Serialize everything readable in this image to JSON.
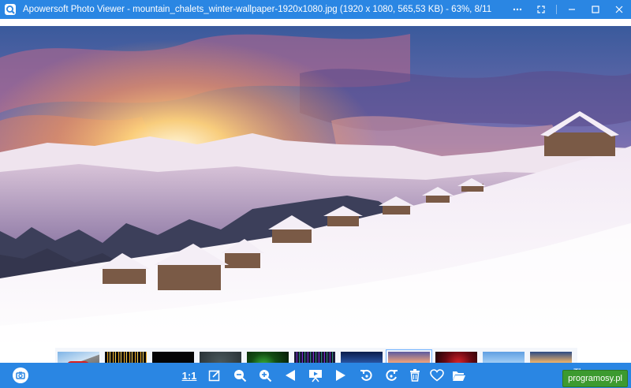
{
  "window": {
    "title": "Apowersoft Photo Viewer - mountain_chalets_winter-wallpaper-1920x1080.jpg (1920 x 1080, 565,53 KB) - 63%, 8/11",
    "controls": [
      "more-icon",
      "fullscreen-icon",
      "minimize-icon",
      "maximize-icon",
      "close-icon"
    ]
  },
  "filmstrip": {
    "count": 11,
    "selected_index": 7,
    "thumbnails": [
      {
        "name": "red-car"
      },
      {
        "name": "golden-lights"
      },
      {
        "name": "black"
      },
      {
        "name": "hexagon-pattern"
      },
      {
        "name": "green-abstract"
      },
      {
        "name": "colorful-lines"
      },
      {
        "name": "blue-road"
      },
      {
        "name": "mountain-chalets-winter"
      },
      {
        "name": "red-abstract"
      },
      {
        "name": "winter-trees"
      },
      {
        "name": "sunset-shore"
      }
    ]
  },
  "toolbar": {
    "ratio_label": "1:1",
    "under_watermark_text": "Th",
    "buttons": [
      "camera-icon",
      "edit-icon",
      "zoom-out-icon",
      "zoom-in-icon",
      "previous-icon",
      "slideshow-icon",
      "next-icon",
      "rotate-left-icon",
      "rotate-right-icon",
      "delete-icon",
      "favorite-icon",
      "open-folder-icon"
    ]
  },
  "watermark": {
    "text": "programosy.pl"
  },
  "colors": {
    "accent": "#2a86e3",
    "watermark_bg": "#3c9a2f"
  }
}
